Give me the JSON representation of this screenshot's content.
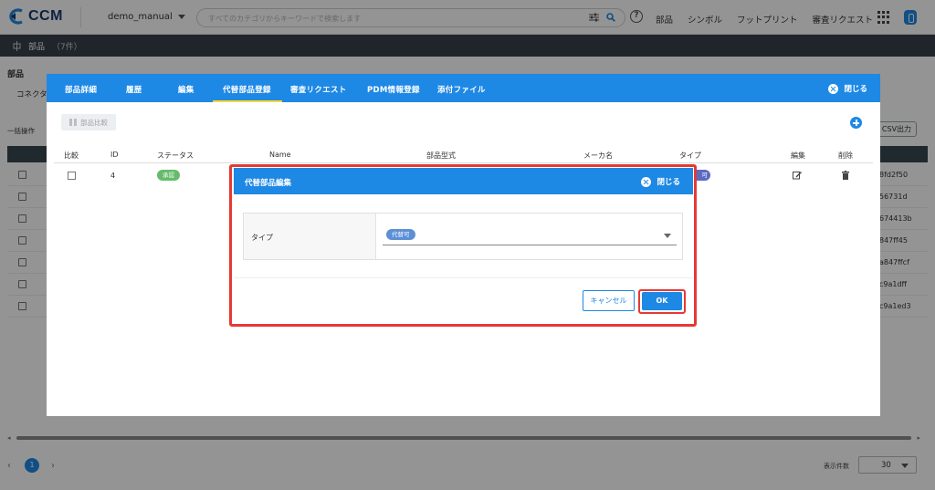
{
  "app": {
    "logo_text": "CCM",
    "project": "demo_manual",
    "search_placeholder": "すべてのカテゴリからキーワードで検索します",
    "nav": [
      "部品",
      "シンボル",
      "フットプリント",
      "審査リクエスト"
    ]
  },
  "subbar": {
    "title": "部品",
    "count": "（7件）"
  },
  "background": {
    "heading": "部品",
    "tab": "コネクタ",
    "bulk_label": "一括操作",
    "csv_label": "CSV出力",
    "row_hashes": [
      "8fd2f50",
      "56731d",
      "674413b",
      "847ff45",
      "a847ffcf",
      "c9a1dff",
      "c9a1ed3"
    ]
  },
  "panel": {
    "tabs": [
      "部品詳細",
      "履歴",
      "編集",
      "代替部品登録",
      "審査リクエスト",
      "PDM情報登録",
      "添付ファイル"
    ],
    "active_tab": "代替部品登録",
    "close_label": "閉じる",
    "compare_button": "部品比較",
    "columns": [
      "比較",
      "ID",
      "ステータス",
      "Name",
      "部品型式",
      "メーカ名",
      "タイプ",
      "編集",
      "削除"
    ],
    "row": {
      "id": "4",
      "status": "承認",
      "type_suffix": "可"
    }
  },
  "dialog": {
    "title": "代替部品編集",
    "close_label": "閉じる",
    "field_label": "タイプ",
    "field_value": "代替可",
    "cancel_label": "キャンセル",
    "ok_label": "OK"
  },
  "footer": {
    "prev": "‹",
    "current_page": "1",
    "next": "›",
    "per_page_label": "表示件数",
    "per_page_value": "30"
  },
  "colors": {
    "accent": "#1e88e5",
    "highlight": "#e53935",
    "subbar": "#36414b"
  }
}
